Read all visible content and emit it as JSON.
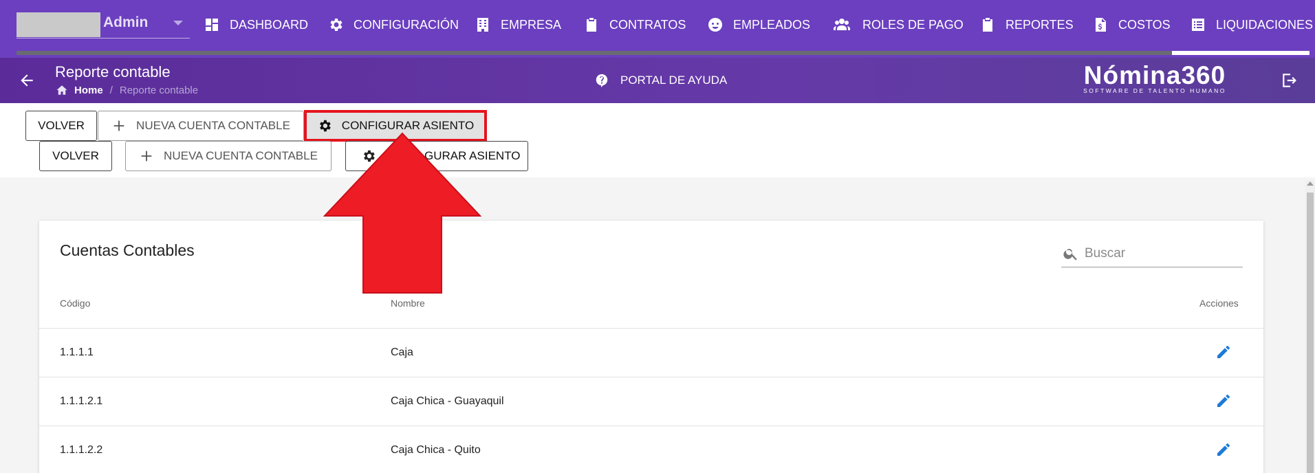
{
  "nav": {
    "company_label": "Admin",
    "items": [
      {
        "label": "DASHBOARD",
        "icon": "dashboard-icon"
      },
      {
        "label": "CONFIGURACIÓN",
        "icon": "gear-icon"
      },
      {
        "label": "EMPRESA",
        "icon": "building-icon"
      },
      {
        "label": "CONTRATOS",
        "icon": "clipboard-icon"
      },
      {
        "label": "EMPLEADOS",
        "icon": "face-icon"
      },
      {
        "label": "ROLES DE PAGO",
        "icon": "users-icon"
      },
      {
        "label": "REPORTES",
        "icon": "clipboard-list-icon"
      },
      {
        "label": "COSTOS",
        "icon": "invoice-dollar-icon"
      },
      {
        "label": "LIQUIDACIONES",
        "icon": "list-icon"
      }
    ],
    "active_item": "LIQUIDACIONES"
  },
  "header": {
    "title": "Reporte contable",
    "breadcrumb_home": "Home",
    "breadcrumb_separator": "/",
    "breadcrumb_current": "Reporte contable",
    "help_label": "PORTAL DE AYUDA",
    "brand_name": "Nómina360",
    "brand_tagline": "SOFTWARE DE TALENTO HUMANO"
  },
  "toolbar": {
    "back_label": "VOLVER",
    "new_account_label": "NUEVA CUENTA CONTABLE",
    "configure_label": "CONFIGURAR ASIENTO",
    "configure_label_partial": "GURAR ASIENTO"
  },
  "card": {
    "title": "Cuentas Contables",
    "search_placeholder": "Buscar",
    "columns": {
      "code": "Código",
      "name": "Nombre",
      "actions": "Acciones"
    },
    "rows": [
      {
        "code": "1.1.1.1",
        "name": "Caja"
      },
      {
        "code": "1.1.1.2.1",
        "name": "Caja Chica - Guayaquil"
      },
      {
        "code": "1.1.1.2.2",
        "name": "Caja Chica - Quito"
      }
    ]
  },
  "colors": {
    "nav_bg": "#6b3fbf",
    "header_bg": "#5b2c99",
    "highlight_border": "#e5141e",
    "edit_icon": "#1e7ad6"
  }
}
